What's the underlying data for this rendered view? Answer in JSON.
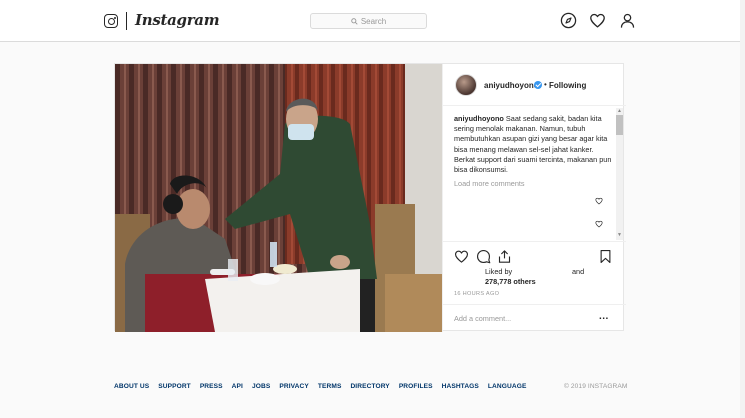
{
  "header": {
    "brand": "Instagram",
    "search_placeholder": "Search",
    "icons": [
      "compass-icon",
      "heart-icon",
      "user-icon"
    ]
  },
  "post": {
    "username": "aniyudhoyono",
    "follow_status": "Following",
    "caption_user": "aniyudhoyono",
    "caption_text": "Saat sedang sakit, badan kita sering menolak makanan. Namun, tubuh membutuhkan asupan gizi yang besar agar kita bisa menang melawan sel-sel jahat kanker. Berkat support dari suami tercinta, makanan pun bisa dikonsumsi.",
    "load_more": "Load more comments",
    "likes_label": "Liked by",
    "likes_and": "and",
    "likes_count": "278,778 others",
    "timestamp": "16 HOURS AGO",
    "comment_placeholder": "Add a comment...",
    "more_options": "..."
  },
  "footer": {
    "links": [
      "ABOUT US",
      "SUPPORT",
      "PRESS",
      "API",
      "JOBS",
      "PRIVACY",
      "TERMS",
      "DIRECTORY",
      "PROFILES",
      "HASHTAGS",
      "LANGUAGE"
    ],
    "copyright": "© 2019 INSTAGRAM"
  },
  "colors": {
    "accent_blue": "#3897f0",
    "link_navy": "#003569",
    "border": "#dbdbdb"
  }
}
